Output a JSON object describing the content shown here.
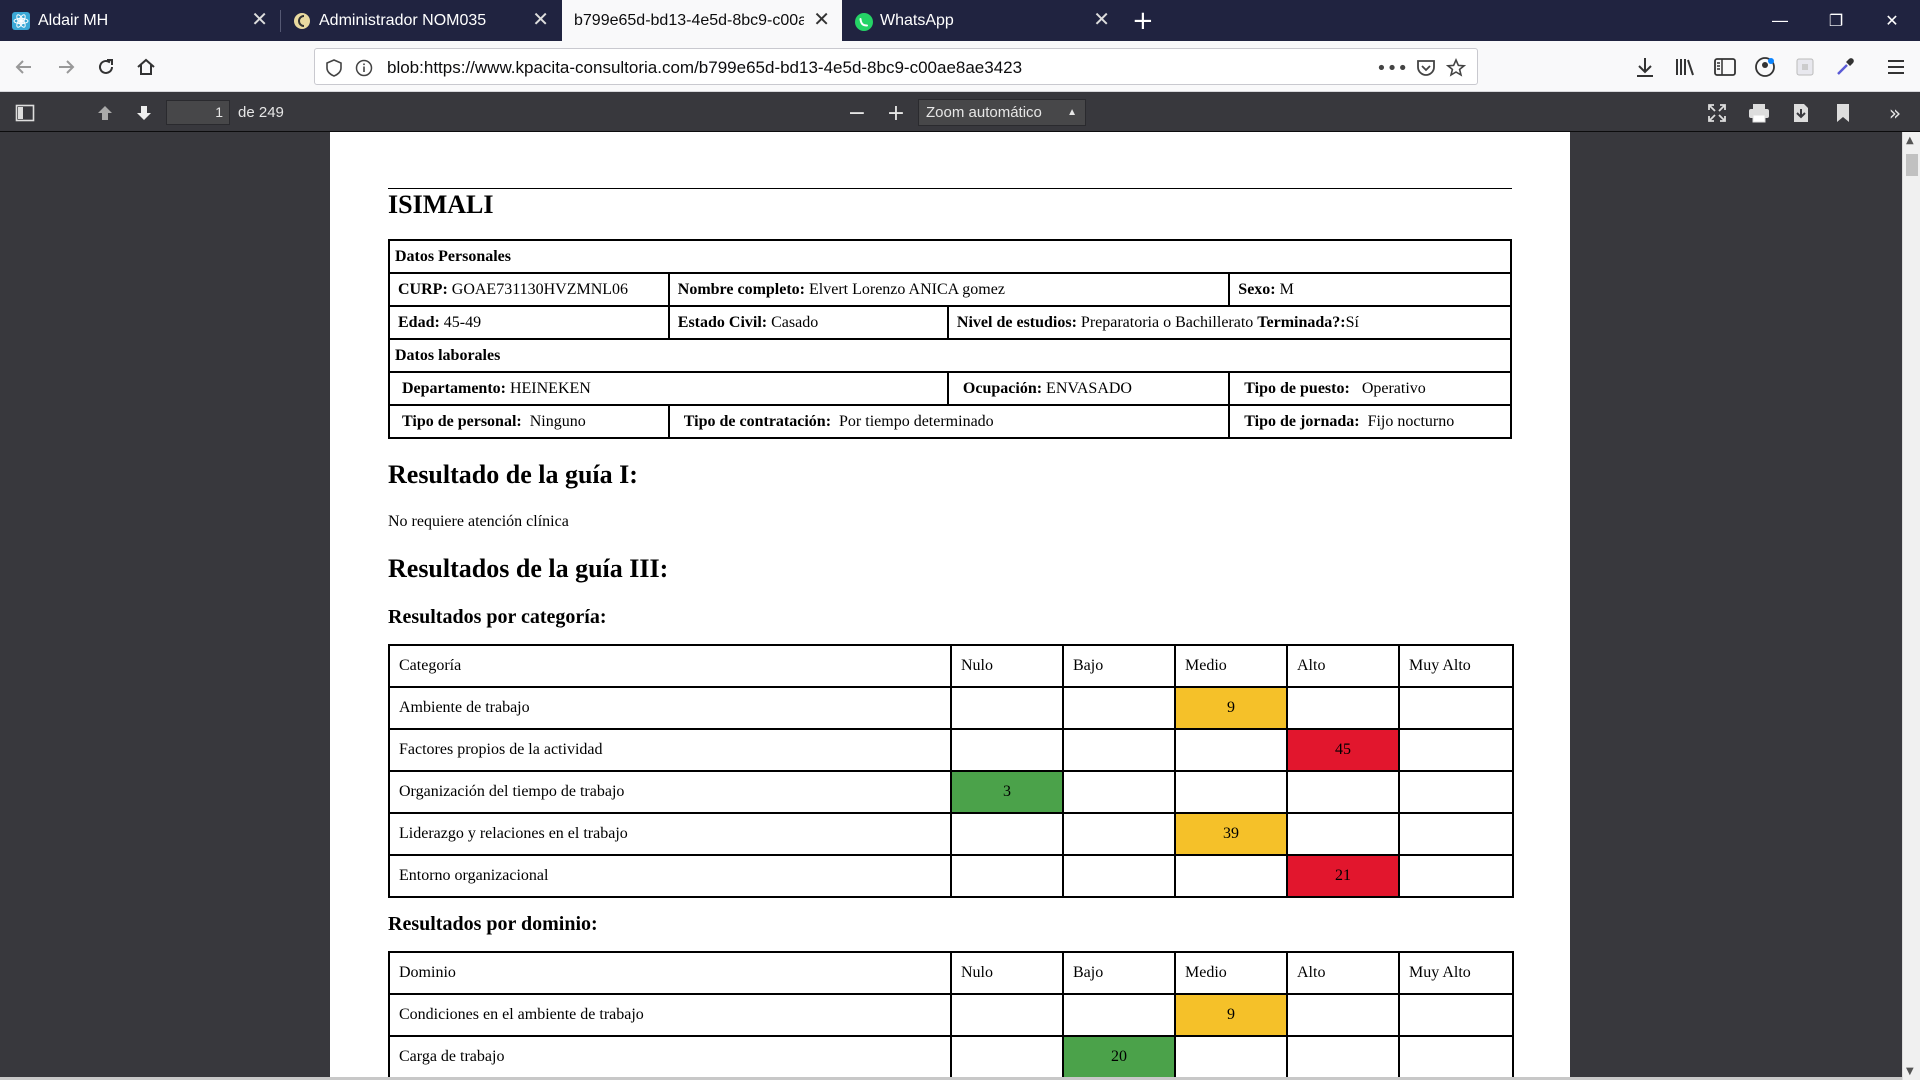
{
  "tabs": [
    {
      "label": "Aldair MH",
      "icon": "react-icon",
      "active": false
    },
    {
      "label": "Administrador NOM035",
      "icon": "site-logo-icon",
      "active": false
    },
    {
      "label": "b799e65d-bd13-4e5d-8bc9-c00ae8ae3423",
      "icon": "",
      "active": true
    },
    {
      "label": "WhatsApp",
      "icon": "whatsapp-icon",
      "active": false
    }
  ],
  "address": {
    "url": "blob:https://www.kpacita-consultoria.com/b799e65d-bd13-4e5d-8bc9-c00ae8ae3423"
  },
  "pdf_toolbar": {
    "page_number": "1",
    "page_total": "de 249",
    "zoom": "Zoom automático"
  },
  "document": {
    "company": "ISIMALI",
    "personal_header": "Datos Personales",
    "curp_label": "CURP:",
    "curp_value": " GOAE731130HVZMNL06",
    "name_label": "Nombre completo:",
    "name_value": " Elvert Lorenzo ANICA gomez",
    "sex_label": "Sexo:",
    "sex_value": " M",
    "age_label": "Edad:",
    "age_value": " 45-49",
    "civil_label": "Estado Civil:",
    "civil_value": " Casado",
    "study_label": "Nivel de estudios:",
    "study_value": " Preparatoria o Bachillerato ",
    "finished_label": "Terminada?:",
    "finished_value": "Sí",
    "labor_header": "Datos laborales",
    "dept_label": "Departamento:",
    "dept_value": " HEINEKEN",
    "occupation_label": "Ocupación:",
    "occupation_value": " ENVASADO",
    "position_label": "Tipo de puesto:",
    "position_value": "   Operativo",
    "staff_label": "Tipo de personal:",
    "staff_value": "  Ninguno",
    "contract_label": "Tipo de contratación:",
    "contract_value": "  Por tiempo determinado",
    "shift_label": "Tipo de jornada:",
    "shift_value": "  Fijo nocturno",
    "guide1_title": "Resultado de la guía I:",
    "guide1_result": "No requiere atención clínica",
    "guide3_title": "Resultados de la guía III:",
    "category_title": "Resultados por categoría:",
    "domain_title": "Resultados por dominio:",
    "levels": [
      "Nulo",
      "Bajo",
      "Medio",
      "Alto",
      "Muy Alto"
    ],
    "category_col": "Categoría",
    "domain_col": "Dominio",
    "colors": {
      "nulo": "#4ba24a",
      "bajo": "#4ba24a",
      "medio": "#f5c129",
      "alto": "#e2162d",
      "muy_alto": "#e2162d"
    },
    "categories": [
      {
        "name": "Ambiente de trabajo",
        "level": 2,
        "value": "9"
      },
      {
        "name": "Factores propios de la actividad",
        "level": 3,
        "value": "45"
      },
      {
        "name": "Organización del tiempo de trabajo",
        "level": 0,
        "value": "3"
      },
      {
        "name": "Liderazgo y relaciones en el trabajo",
        "level": 2,
        "value": "39"
      },
      {
        "name": "Entorno organizacional",
        "level": 3,
        "value": "21"
      }
    ],
    "domains": [
      {
        "name": "Condiciones en el ambiente de trabajo",
        "level": 2,
        "value": "9"
      },
      {
        "name": "Carga de trabajo",
        "level": 1,
        "value": "20"
      }
    ]
  }
}
